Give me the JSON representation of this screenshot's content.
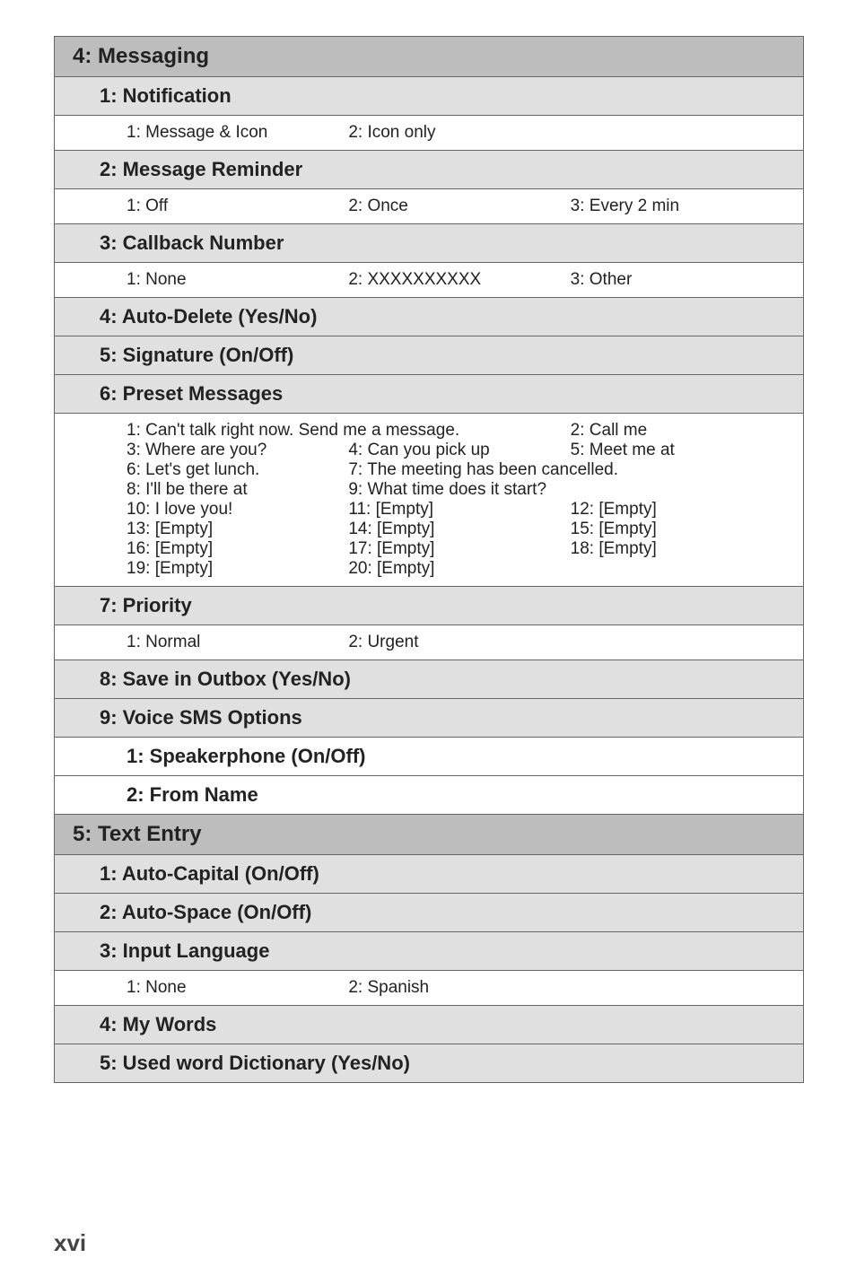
{
  "page_number": "xvi",
  "sections": {
    "messaging": {
      "title": "4: Messaging",
      "notification": {
        "title": "1: Notification",
        "opts": {
          "a": "1: Message & Icon",
          "b": "2: Icon only"
        }
      },
      "reminder": {
        "title": "2: Message Reminder",
        "opts": {
          "a": "1: Off",
          "b": "2: Once",
          "c": "3: Every 2 min"
        }
      },
      "callback": {
        "title": "3: Callback Number",
        "opts": {
          "a": "1: None",
          "b": "2: XXXXXXXXXX",
          "c": "3: Other"
        }
      },
      "autodelete": {
        "title": "4: Auto-Delete (Yes/No)"
      },
      "signature": {
        "title": "5: Signature (On/Off)"
      },
      "preset": {
        "title": "6: Preset Messages",
        "opts": {
          "r1a": "1: Can't talk right now. Send me a message.",
          "r1c": "2: Call me",
          "r2a": "3: Where are you?",
          "r2b": "4: Can you pick up",
          "r2c": "5: Meet me at",
          "r3a": "6: Let's get lunch.",
          "r3b": "7: The meeting has been cancelled.",
          "r4a": "8: I'll be there at",
          "r4b": "9: What time does it start?",
          "r5a": "10: I love you!",
          "r5b": "11: [Empty]",
          "r5c": "12: [Empty]",
          "r6a": "13: [Empty]",
          "r6b": "14: [Empty]",
          "r6c": "15: [Empty]",
          "r7a": "16: [Empty]",
          "r7b": "17: [Empty]",
          "r7c": "18: [Empty]",
          "r8a": "19: [Empty]",
          "r8b": "20: [Empty]"
        }
      },
      "priority": {
        "title": "7: Priority",
        "opts": {
          "a": "1: Normal",
          "b": "2: Urgent"
        }
      },
      "saveoutbox": {
        "title": "8: Save in Outbox (Yes/No)"
      },
      "voicesms": {
        "title": "9: Voice SMS Options",
        "speakerphone": {
          "title": "1: Speakerphone (On/Off)"
        },
        "fromname": {
          "title": "2: From Name"
        }
      }
    },
    "textentry": {
      "title": "5: Text Entry",
      "autocapital": {
        "title": "1: Auto-Capital (On/Off)"
      },
      "autospace": {
        "title": "2: Auto-Space (On/Off)"
      },
      "inputlang": {
        "title": "3: Input Language",
        "opts": {
          "a": "1: None",
          "b": "2: Spanish"
        }
      },
      "mywords": {
        "title": "4: My Words"
      },
      "useddict": {
        "title": "5: Used word Dictionary (Yes/No)"
      }
    }
  }
}
